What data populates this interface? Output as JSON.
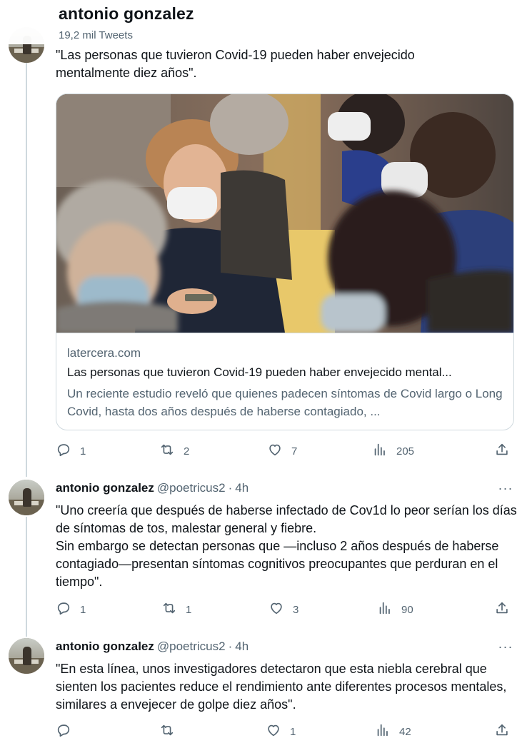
{
  "header": {
    "name": "antonio gonzalez",
    "tweet_count": "19,2 mil Tweets"
  },
  "main_tweet": {
    "text": "\"Las personas que tuvieron Covid-19 pueden haber envejecido mentalmente diez años\".",
    "card": {
      "domain": "latercera.com",
      "title": "Las personas que tuvieron Covid-19 pueden haber envejecido mental...",
      "description": "Un reciente estudio reveló que quienes padecen síntomas de Covid largo o Long Covid, hasta dos años después de haberse contagiado, ..."
    },
    "actions": {
      "replies": "1",
      "retweets": "2",
      "likes": "7",
      "views": "205"
    }
  },
  "replies": [
    {
      "name": "antonio gonzalez",
      "handle": "@poetricus2",
      "sep": "·",
      "time": "4h",
      "text": "\"Uno creería que después de haberse infectado de Cov1d lo peor serían los días de síntomas de tos, malestar general y fiebre.\nSin embargo se detectan personas que —incluso 2 años después de haberse contagiado—presentan síntomas cognitivos preocupantes que perduran en el tiempo\".",
      "actions": {
        "replies": "1",
        "retweets": "1",
        "likes": "3",
        "views": "90"
      }
    },
    {
      "name": "antonio gonzalez",
      "handle": "@poetricus2",
      "sep": "·",
      "time": "4h",
      "text": "\"En esta línea, unos investigadores detectaron que esta niebla cerebral que sienten los pacientes reduce el rendimiento ante diferentes procesos mentales, similares a envejecer de golpe diez años\".",
      "actions": {
        "replies": "",
        "retweets": "",
        "likes": "1",
        "views": "42"
      }
    }
  ],
  "more_label": "···",
  "icons": [
    "reply-icon",
    "retweet-icon",
    "like-icon",
    "views-icon",
    "share-icon",
    "more-icon"
  ],
  "colors": {
    "text": "#0f1419",
    "secondary": "#536471",
    "border": "#cfd9de"
  }
}
